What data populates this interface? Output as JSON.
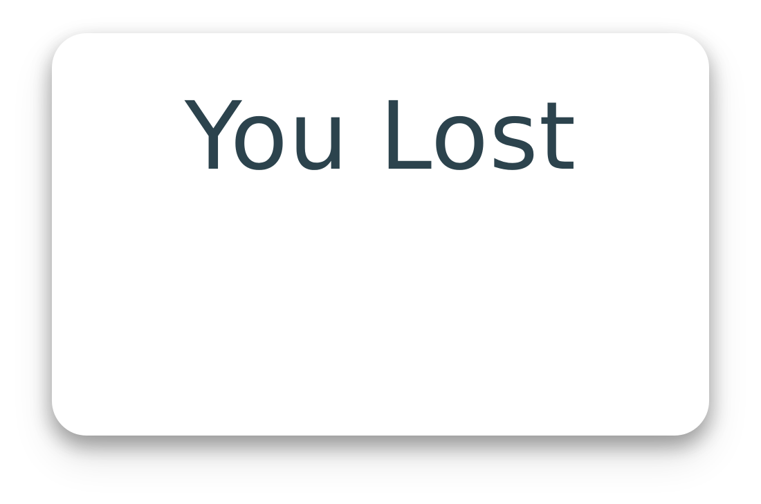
{
  "dialog": {
    "title": "You Lost"
  },
  "colors": {
    "title_text": "#2c434d",
    "card_background": "#ffffff",
    "page_background": "#ffffff"
  }
}
